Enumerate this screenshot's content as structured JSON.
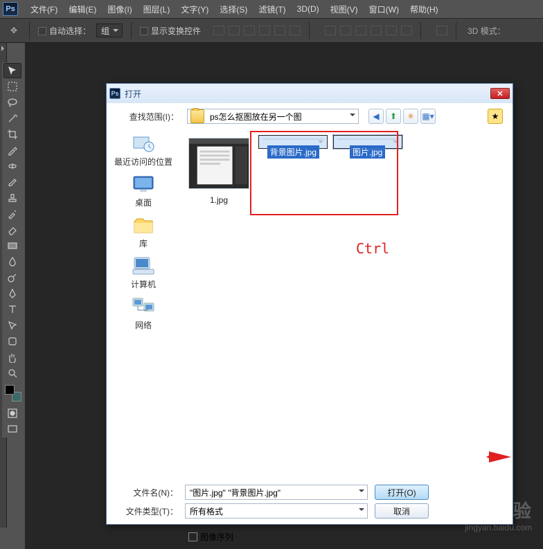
{
  "app": {
    "logo": "Ps"
  },
  "menu": [
    "文件(F)",
    "编辑(E)",
    "图像(I)",
    "图层(L)",
    "文字(Y)",
    "选择(S)",
    "滤镜(T)",
    "3D(D)",
    "视图(V)",
    "窗口(W)",
    "帮助(H)"
  ],
  "options": {
    "autoSelect": "自动选择：",
    "group": "组",
    "showTransform": "显示变换控件",
    "mode3d": "3D 模式："
  },
  "dialog": {
    "title": "打开",
    "lookInLabel": "查找范围(I)：",
    "lookInValue": "ps怎么抠图放在另一个图",
    "places": [
      {
        "label": "最近访问的位置",
        "icon": "recent"
      },
      {
        "label": "桌面",
        "icon": "desktop"
      },
      {
        "label": "库",
        "icon": "library"
      },
      {
        "label": "计算机",
        "icon": "computer"
      },
      {
        "label": "网络",
        "icon": "network"
      }
    ],
    "files": [
      {
        "name": "1.jpg",
        "kind": "ps-screenshot",
        "selected": false
      },
      {
        "name": "背景图片.jpg",
        "kind": "grass-sky",
        "selected": true
      },
      {
        "name": "图片.jpg",
        "kind": "tiger",
        "selected": true
      }
    ],
    "ctrlHint": "Ctrl",
    "fileNameLabel": "文件名(N)：",
    "fileNameValue": "\"图片.jpg\" \"背景图片.jpg\"",
    "fileTypeLabel": "文件类型(T)：",
    "fileTypeValue": "所有格式",
    "imageSequence": "图像序列",
    "openBtn": "打开(O)",
    "cancelBtn": "取消"
  },
  "watermark": {
    "big": "Baidu 经验",
    "small": "jingyan.baidu.com"
  }
}
